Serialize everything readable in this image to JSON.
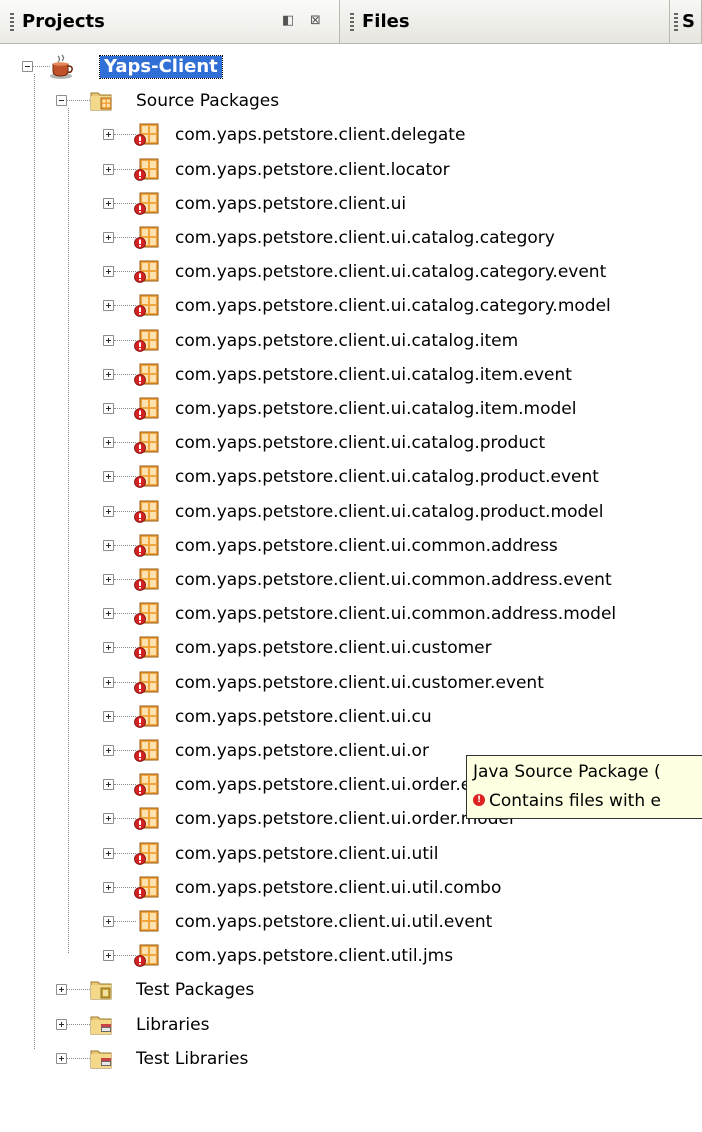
{
  "tabs": [
    {
      "label": "Projects",
      "active": true
    },
    {
      "label": "Files",
      "active": false
    },
    {
      "label": "S",
      "active": false
    }
  ],
  "tab_controls": {
    "minimize_glyph": "◧",
    "close_glyph": "⊠"
  },
  "tree": {
    "root": {
      "label": "Yaps-Client",
      "icon": "coffee-cup-project-icon",
      "expanded": true,
      "selected": true
    },
    "source_packages": {
      "label": "Source Packages",
      "icon": "source-folder-icon",
      "expanded": true
    },
    "packages": [
      {
        "label": "com.yaps.petstore.client.delegate",
        "error": true
      },
      {
        "label": "com.yaps.petstore.client.locator",
        "error": true
      },
      {
        "label": "com.yaps.petstore.client.ui",
        "error": true
      },
      {
        "label": "com.yaps.petstore.client.ui.catalog.category",
        "error": true
      },
      {
        "label": "com.yaps.petstore.client.ui.catalog.category.event",
        "error": true
      },
      {
        "label": "com.yaps.petstore.client.ui.catalog.category.model",
        "error": true
      },
      {
        "label": "com.yaps.petstore.client.ui.catalog.item",
        "error": true
      },
      {
        "label": "com.yaps.petstore.client.ui.catalog.item.event",
        "error": true
      },
      {
        "label": "com.yaps.petstore.client.ui.catalog.item.model",
        "error": true
      },
      {
        "label": "com.yaps.petstore.client.ui.catalog.product",
        "error": true
      },
      {
        "label": "com.yaps.petstore.client.ui.catalog.product.event",
        "error": true
      },
      {
        "label": "com.yaps.petstore.client.ui.catalog.product.model",
        "error": true
      },
      {
        "label": "com.yaps.petstore.client.ui.common.address",
        "error": true
      },
      {
        "label": "com.yaps.petstore.client.ui.common.address.event",
        "error": true
      },
      {
        "label": "com.yaps.petstore.client.ui.common.address.model",
        "error": true
      },
      {
        "label": "com.yaps.petstore.client.ui.customer",
        "error": true
      },
      {
        "label": "com.yaps.petstore.client.ui.customer.event",
        "error": true
      },
      {
        "label": "com.yaps.petstore.client.ui.cu",
        "error": true
      },
      {
        "label": "com.yaps.petstore.client.ui.or",
        "error": true
      },
      {
        "label": "com.yaps.petstore.client.ui.order.event",
        "error": true
      },
      {
        "label": "com.yaps.petstore.client.ui.order.model",
        "error": true
      },
      {
        "label": "com.yaps.petstore.client.ui.util",
        "error": true
      },
      {
        "label": "com.yaps.petstore.client.ui.util.combo",
        "error": true
      },
      {
        "label": "com.yaps.petstore.client.ui.util.event",
        "error": false
      },
      {
        "label": "com.yaps.petstore.client.util.jms",
        "error": true
      }
    ],
    "others": [
      {
        "label": "Test Packages",
        "icon": "test-folder-icon"
      },
      {
        "label": "Libraries",
        "icon": "library-folder-icon"
      },
      {
        "label": "Test Libraries",
        "icon": "test-library-folder-icon"
      }
    ]
  },
  "tooltip": {
    "line1": "Java Source Package (",
    "line2": "Contains files with e",
    "error_glyph": "!"
  },
  "colors": {
    "selection": "#2f6fd6",
    "tooltip_bg": "#ffffe1",
    "package_orange": "#f2a33a",
    "error_red": "#d22222"
  }
}
